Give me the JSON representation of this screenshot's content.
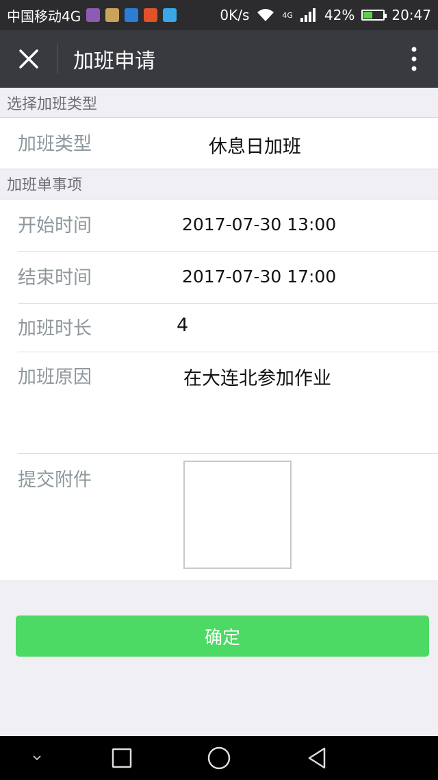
{
  "status_bar": {
    "carrier": "中国移动4G",
    "speed": "0K/s",
    "network": "4G",
    "battery": "42%",
    "battery_level": 0.42,
    "time": "20:47"
  },
  "title_bar": {
    "title": "加班申请",
    "close_icon": "close-icon",
    "more_icon": "more-vertical-icon"
  },
  "sections": {
    "type_header": "选择加班类型",
    "items_header": "加班单事项"
  },
  "form": {
    "type_label": "加班类型",
    "type_value": "休息日加班",
    "start_label": "开始时间",
    "start_value": "2017-07-30 13:00",
    "end_label": "结束时间",
    "end_value": "2017-07-30 17:00",
    "duration_label": "加班时长",
    "duration_value": "4",
    "reason_label": "加班原因",
    "reason_value": "在大连北参加作业",
    "attachment_label": "提交附件"
  },
  "actions": {
    "submit_label": "确定"
  },
  "colors": {
    "primary_green": "#4cd964",
    "titlebar": "#393a3f"
  }
}
